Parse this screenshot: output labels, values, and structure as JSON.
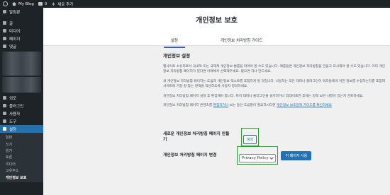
{
  "adminbar": {
    "site_name": "My Blog",
    "comments_count": "0",
    "new_label": "새로 추가"
  },
  "sidebar": {
    "items": [
      {
        "label": "알림판",
        "icon": "dashboard-icon"
      },
      {
        "label": "글",
        "icon": "pin-icon"
      },
      {
        "label": "미디어",
        "icon": "media-icon"
      },
      {
        "label": "페이지",
        "icon": "page-icon"
      },
      {
        "label": "댓글",
        "icon": "comment-icon"
      },
      {
        "label": "외모",
        "icon": "brush-icon"
      },
      {
        "label": "플러그인",
        "icon": "plugin-icon"
      },
      {
        "label": "사용자",
        "icon": "user-icon"
      },
      {
        "label": "도구",
        "icon": "wrench-icon"
      },
      {
        "label": "설정",
        "icon": "settings-icon"
      }
    ],
    "submenu": [
      {
        "label": "일반"
      },
      {
        "label": "쓰기"
      },
      {
        "label": "읽기"
      },
      {
        "label": "토론"
      },
      {
        "label": "미디어"
      },
      {
        "label": "고유주소"
      },
      {
        "label": "개인정보 보호"
      }
    ]
  },
  "header": {
    "title": "개인정보 보호",
    "tabs": [
      {
        "label": "설정"
      },
      {
        "label": "개인정보 처리방침 가이드"
      }
    ]
  },
  "main": {
    "section_title": "개인정보 설정",
    "para1": "웹사이트 소유자로서 국내적 또는 국제적 개인정보 법률을 따라야 할 수도 있습니다. 예를들면 개인정보 처리방침을 만들고 표시해야 할 수도 있습니다. 이미 개인정보 처리방침 페이지가 있다면 아래에서 선택해주세요. 없으면 하나 만드세요.",
    "para2": "새 개인정보 처리방침 페이지는 도움과 개인정보 텍스트를 포함하게 될 것입니다. 사용하는 모든 테마나 플러그인이 독자들에게 어떤 정보를 수집하는지를 포함해 사이트에 가장 잘 맞는 정책을 작성하도록 사용자 정의하세요.",
    "para3": "개인정보 처리방침 페이지 설정 후 편집해야 합니다. 특히 테마나 플러그인을 설치하거나 업데이트한 후에는 정책 보완 사항이 있는지 검토하세요.",
    "para4_prefix": "개인정보 처리방침 페이지 콘텐츠를",
    "para4_link1": "편집하거나",
    "para4_middle": "보는 동안 도움말이 필요하시다면",
    "para4_link2": "개인정보 보호정책 가이드를 확인하세요",
    "create_label": "새로운 개인정보 처리방침 페이지 만들기",
    "create_button": "생성",
    "change_label": "개인정보 처리방침 페이지 변경",
    "select_value": "Privacy Policy",
    "use_button": "이 페이지 사용"
  }
}
